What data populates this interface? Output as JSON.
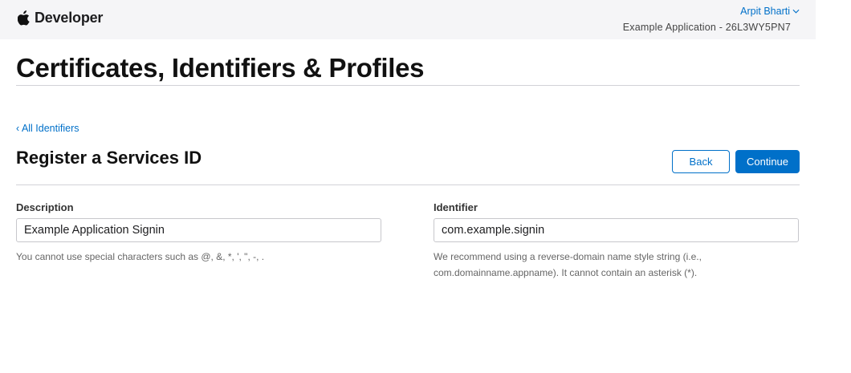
{
  "header": {
    "brand": "Developer",
    "user_name": "Arpit Bharti",
    "team": "Example Application - 26L3WY5PN7"
  },
  "page": {
    "title": "Certificates, Identifiers & Profiles",
    "back_link": "‹ All Identifiers",
    "section_title": "Register a Services ID"
  },
  "actions": {
    "back_label": "Back",
    "continue_label": "Continue"
  },
  "form": {
    "description": {
      "label": "Description",
      "value": "Example Application Signin",
      "hint": "You cannot use special characters such as @, &, *, ', \", -, ."
    },
    "identifier": {
      "label": "Identifier",
      "value": "com.example.signin",
      "hint_line1": "We recommend using a reverse-domain name style string (i.e.,",
      "hint_line2": "com.domainname.appname). It cannot contain an asterisk (*)."
    }
  },
  "colors": {
    "accent": "#0070c9",
    "topbar": "#f5f5f7",
    "divider": "#d2d2d7"
  },
  "icons": {
    "brand": "apple-logo-icon",
    "user_menu": "chevron-down-icon"
  }
}
